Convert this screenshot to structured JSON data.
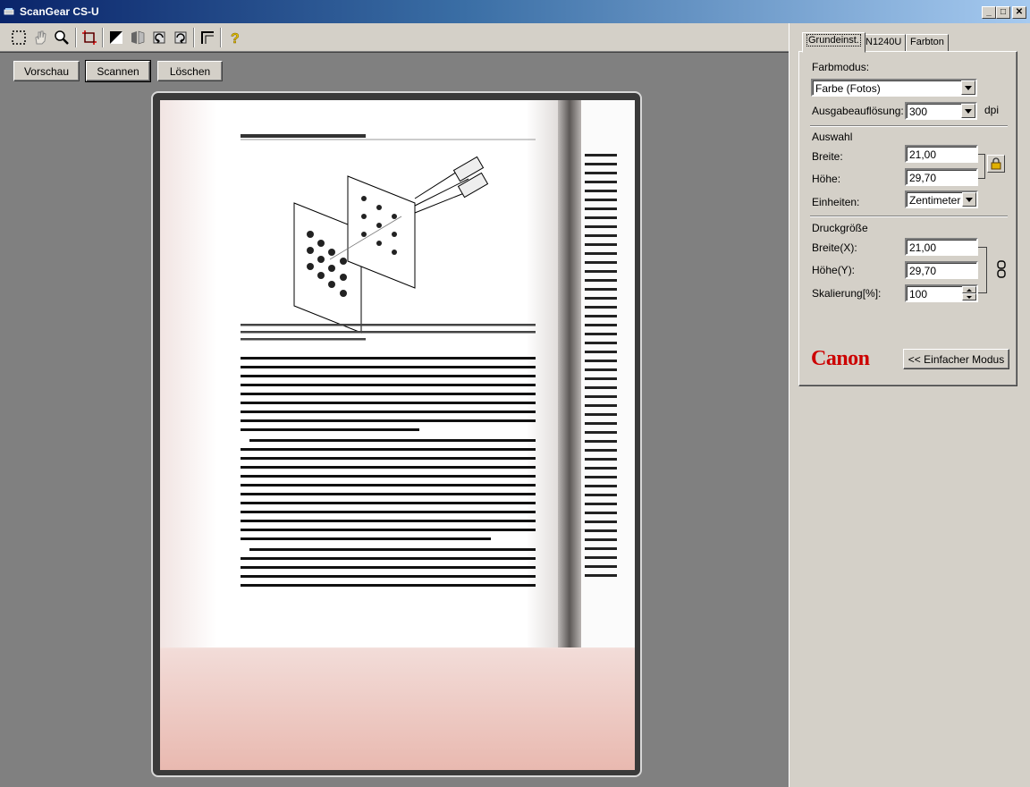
{
  "window": {
    "title": "ScanGear CS-U",
    "minimize": "_",
    "maximize": "□",
    "close": "✕"
  },
  "toolbar": {
    "tools": [
      {
        "name": "select-area-icon",
        "label": "Auswahlrahmen"
      },
      {
        "name": "hand-icon",
        "label": "Verschieben"
      },
      {
        "name": "zoom-icon",
        "label": "Zoom"
      },
      {
        "name": "crop-icon",
        "label": "Beschneiden"
      },
      {
        "name": "invert-icon",
        "label": "Invertieren"
      },
      {
        "name": "mirror-icon",
        "label": "Spiegeln"
      },
      {
        "name": "rotate-left-icon",
        "label": "Links drehen"
      },
      {
        "name": "rotate-right-icon",
        "label": "Rechts drehen"
      },
      {
        "name": "auto-crop-icon",
        "label": "Automatische Auswahl"
      },
      {
        "name": "help-icon",
        "label": "?"
      }
    ]
  },
  "actions": {
    "preview": "Vorschau",
    "scan": "Scannen",
    "clear": "Löschen"
  },
  "tabs": [
    "Grundeinst.",
    "N1240U",
    "Farbton"
  ],
  "settings": {
    "color_mode_label": "Farbmodus:",
    "color_mode_value": "Farbe (Fotos)",
    "resolution_label": "Ausgabeauflösung:",
    "resolution_value": "300",
    "resolution_unit": "dpi",
    "selection_heading": "Auswahl",
    "width_label": "Breite:",
    "width_value": "21,00",
    "height_label": "Höhe:",
    "height_value": "29,70",
    "units_label": "Einheiten:",
    "units_value": "Zentimeter",
    "print_heading": "Druckgröße",
    "print_width_label": "Breite(X):",
    "print_width_value": "21,00",
    "print_height_label": "Höhe(Y):",
    "print_height_value": "29,70",
    "scaling_label": "Skalierung[%]:",
    "scaling_value": "100"
  },
  "brand": {
    "logo": "Canon",
    "color": "#cc0000"
  },
  "simple_mode_button": "<< Einfacher Modus",
  "colors": {
    "workspace": "#808080",
    "panel": "#d4d0c8",
    "titlebar": "#0a246a"
  }
}
